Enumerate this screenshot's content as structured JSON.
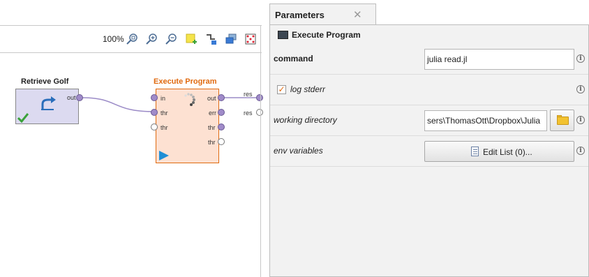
{
  "canvas": {
    "zoom": "100%",
    "toolbar_icons": [
      "zoom-fit-icon",
      "zoom-in-icon",
      "zoom-out-icon",
      "add-note-icon",
      "wire-icon",
      "arrange-icon",
      "auto-layout-icon"
    ],
    "operators": [
      {
        "title": "Retrieve Golf",
        "ports_out": [
          "out"
        ]
      },
      {
        "title": "Execute Program",
        "ports_in": [
          "in",
          "thr",
          "thr"
        ],
        "ports_out": [
          "out",
          "err",
          "thr",
          "thr"
        ]
      }
    ],
    "result_ports": [
      "res",
      "res"
    ]
  },
  "parameters": {
    "tab_label": "Parameters",
    "tab_close": "✕",
    "operator_name": "Execute Program",
    "rows": [
      {
        "label": "command",
        "value": "julia read.jl"
      },
      {
        "label": "log stderr",
        "checked": true
      },
      {
        "label": "working directory",
        "value": "sers\\ThomasOtt\\Dropbox\\Julia"
      },
      {
        "label": "env variables",
        "button_label": "Edit List (0)..."
      }
    ],
    "info_glyph": "i"
  },
  "colors": {
    "execute_title": "#e06a10",
    "execute_fill": "#fde1d2",
    "execute_border": "#e06a10",
    "retrieve_fill": "#dcdaf0",
    "port_fill": "#a08bc9",
    "wire": "#9b8bc7",
    "checkbox_check": "#e06a10"
  }
}
